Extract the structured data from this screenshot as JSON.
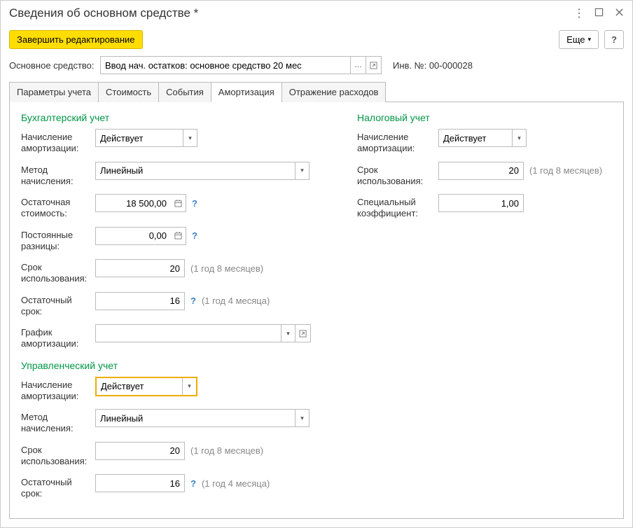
{
  "window": {
    "title": "Сведения об основном средстве *"
  },
  "toolbar": {
    "finish": "Завершить редактирование",
    "more": "Еще",
    "help": "?"
  },
  "main_asset": {
    "label": "Основное средство:",
    "value": "Ввод нач. остатков: основное средство 20 мес",
    "inv_label": "Инв. №: 00-000028"
  },
  "tabs": [
    "Параметры учета",
    "Стоимость",
    "События",
    "Амортизация",
    "Отражение расходов"
  ],
  "sections": {
    "accounting": {
      "title": "Бухгалтерский учет",
      "depreciation_label": "Начисление амортизации:",
      "depreciation_value": "Действует",
      "method_label": "Метод начисления:",
      "method_value": "Линейный",
      "residual_value_label": "Остаточная стоимость:",
      "residual_value": "18 500,00",
      "perm_diff_label": "Постоянные разницы:",
      "perm_diff_value": "0,00",
      "use_period_label": "Срок использования:",
      "use_period_value": "20",
      "use_period_hint": "(1 год 8 месяцев)",
      "remaining_label": "Остаточный срок:",
      "remaining_value": "16",
      "remaining_hint": "(1 год 4 месяца)",
      "schedule_label": "График амортизации:",
      "schedule_value": ""
    },
    "management": {
      "title": "Управленческий учет",
      "depreciation_label": "Начисление амортизации:",
      "depreciation_value": "Действует",
      "method_label": "Метод начисления:",
      "method_value": "Линейный",
      "use_period_label": "Срок использования:",
      "use_period_value": "20",
      "use_period_hint": "(1 год 8 месяцев)",
      "remaining_label": "Остаточный срок:",
      "remaining_value": "16",
      "remaining_hint": "(1 год 4 месяца)"
    },
    "tax": {
      "title": "Налоговый учет",
      "depreciation_label": "Начисление амортизации:",
      "depreciation_value": "Действует",
      "use_period_label": "Срок использования:",
      "use_period_value": "20",
      "use_period_hint": "(1 год 8 месяцев)",
      "coeff_label": "Специальный коэффициент:",
      "coeff_value": "1,00"
    }
  }
}
